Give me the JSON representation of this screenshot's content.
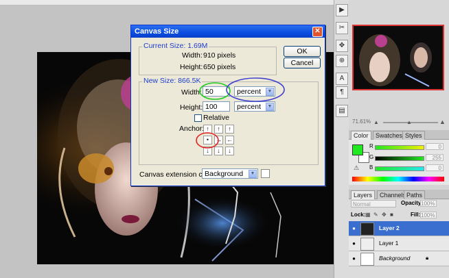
{
  "dialog": {
    "title": "Canvas Size",
    "close_label": "✕",
    "current_size": {
      "legend": "Current Size: 1.69M",
      "width_label": "Width:",
      "width_value": "910 pixels",
      "height_label": "Height:",
      "height_value": "650 pixels"
    },
    "new_size": {
      "legend": "New Size: 866.5K",
      "width_label": "Width:",
      "width_value": "50",
      "width_unit": "percent",
      "height_label": "Height:",
      "height_value": "100",
      "height_unit": "percent",
      "relative_label": "Relative",
      "relative_checked": false,
      "anchor_label": "Anchor:",
      "anchor_arrows": [
        "↖",
        "↑",
        "↗",
        "←",
        "·",
        "→",
        "↙",
        "↓",
        "↘"
      ],
      "anchor_glyphs": [
        "↑",
        "↑",
        "↑",
        "•",
        "→",
        "←",
        "↓",
        "↓",
        "↓"
      ]
    },
    "ok_label": "OK",
    "cancel_label": "Cancel",
    "extension_label": "Canvas extension color:",
    "extension_value": "Background"
  },
  "navigator": {
    "zoom": "71.61%"
  },
  "color_panel": {
    "tabs": [
      "Color",
      "Swatches",
      "Styles"
    ],
    "foreground": "#22e822",
    "background": "#ffffff",
    "channels": [
      {
        "label": "R",
        "value": "0"
      },
      {
        "label": "G",
        "value": "255"
      },
      {
        "label": "B",
        "value": "0"
      }
    ]
  },
  "layers_panel": {
    "tabs": [
      "Layers",
      "Channels",
      "Paths"
    ],
    "blend_mode": "Normal",
    "opacity_label": "Opacity:",
    "opacity_value": "100%",
    "lock_label": "Lock:",
    "fill_label": "Fill:",
    "fill_value": "100%",
    "layers": [
      {
        "name": "Layer 2",
        "selected": true
      },
      {
        "name": "Layer 1",
        "selected": false
      },
      {
        "name": "Background",
        "selected": false
      }
    ]
  },
  "tool_icons": [
    "history-icon",
    "tools-icon",
    "move-icon",
    "character-icon",
    "paragraph-icon",
    "layer-comps-icon"
  ]
}
